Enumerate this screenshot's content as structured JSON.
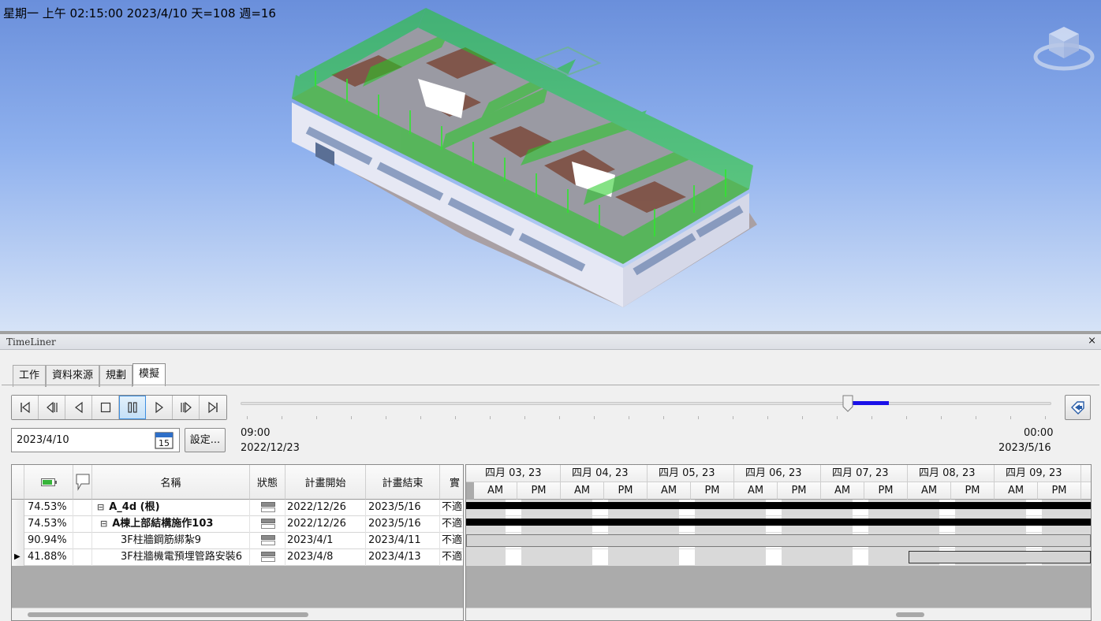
{
  "viewport": {
    "sim_time_text": "星期一 上午 02:15:00 2023/4/10 天=108 週=16"
  },
  "panel": {
    "title": "TimeLiner",
    "close_glyph": "×"
  },
  "tabs": [
    {
      "label": "工作",
      "active": false
    },
    {
      "label": "資料來源",
      "active": false
    },
    {
      "label": "規劃",
      "active": false
    },
    {
      "label": "模擬",
      "active": true
    }
  ],
  "transport": {
    "buttons": [
      "rewind-to-start",
      "step-back",
      "play-reverse",
      "stop",
      "pause",
      "play",
      "step-forward",
      "forward-to-end"
    ],
    "active_button": "pause"
  },
  "slider": {
    "position_fraction": 0.749,
    "start_time": "09:00",
    "start_date": "2022/12/23",
    "end_time": "00:00",
    "end_date": "2023/5/16"
  },
  "date_field": {
    "value": "2023/4/10"
  },
  "calendar_day": "15",
  "settings_label": "設定...",
  "grid": {
    "headers": {
      "name": "名稱",
      "status": "狀態",
      "planned_start": "計畫開始",
      "planned_end": "計畫結束",
      "actual": "實"
    },
    "rows": [
      {
        "marker": "",
        "percent": "74.53%",
        "expander": "⊟",
        "name": "A_4d (根)",
        "bold": true,
        "planned_start": "2022/12/26",
        "planned_end": "2023/5/16",
        "actual": "不適"
      },
      {
        "marker": "",
        "percent": "74.53%",
        "expander": "⊟",
        "name": "A棟上部結構施作103",
        "bold": true,
        "planned_start": "2022/12/26",
        "planned_end": "2023/5/16",
        "actual": "不適"
      },
      {
        "marker": "",
        "percent": "90.94%",
        "expander": "",
        "name": "3F柱牆鋼筋綁紮9",
        "bold": false,
        "planned_start": "2023/4/1",
        "planned_end": "2023/4/11",
        "actual": "不適"
      },
      {
        "marker": "▶",
        "percent": "41.88%",
        "expander": "",
        "name": "3F柱牆機電預埋管路安裝6",
        "bold": false,
        "planned_start": "2023/4/8",
        "planned_end": "2023/4/13",
        "actual": "不適"
      }
    ]
  },
  "gantt": {
    "dates": [
      "四月 03, 23",
      "四月 04, 23",
      "四月 05, 23",
      "四月 06, 23",
      "四月 07, 23",
      "四月 08, 23",
      "四月 09, 23"
    ],
    "am_label": "AM",
    "pm_label": "PM"
  },
  "colors": {
    "slider_progress": "#1a10e8",
    "gantt_bar": "#000000",
    "model_progress": "#22cc22"
  }
}
